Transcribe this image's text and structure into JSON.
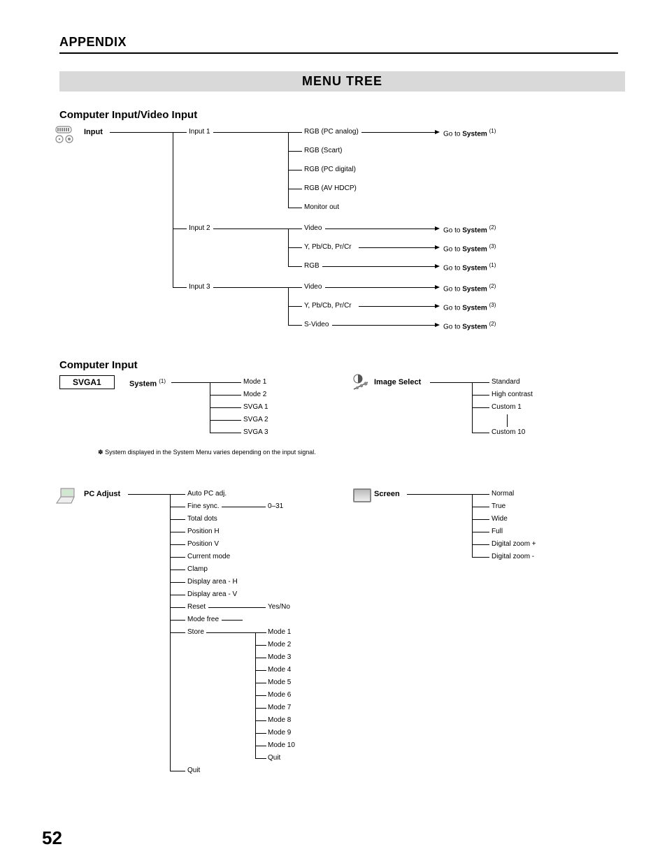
{
  "header": {
    "appendix": "APPENDIX",
    "banner": "MENU TREE"
  },
  "sections": {
    "s1_heading": "Computer Input/Video Input",
    "s2_heading": "Computer Input"
  },
  "input_tree": {
    "root": "Input",
    "input1": "Input 1",
    "input2": "Input 2",
    "input3": "Input 3",
    "i1": {
      "a": "RGB (PC analog)",
      "b": "RGB (Scart)",
      "c": "RGB (PC digital)",
      "d": "RGB (AV HDCP)",
      "e": "Monitor out"
    },
    "i2": {
      "a": "Video",
      "b": "Y, Pb/Cb, Pr/Cr",
      "c": "RGB"
    },
    "i3": {
      "a": "Video",
      "b": "Y, Pb/Cb, Pr/Cr",
      "c": "S-Video"
    },
    "goto": "Go to ",
    "system": "System",
    "sup1": "(1)",
    "sup2": "(2)",
    "sup3": "(3)"
  },
  "system_tree": {
    "svga_box": "SVGA1",
    "root": "System",
    "sup": "(1)",
    "m1": "Mode 1",
    "m2": "Mode 2",
    "m3": "SVGA 1",
    "m4": "SVGA 2",
    "m5": "SVGA 3",
    "note": "System displayed in the System Menu varies depending on the input signal.",
    "ast": "✽"
  },
  "image_select": {
    "root": "Image Select",
    "a": "Standard",
    "b": "High contrast",
    "c": "Custom 1",
    "d": "Custom 10"
  },
  "pc_adjust": {
    "root": "PC Adjust",
    "items": {
      "a": "Auto PC adj.",
      "b": "Fine sync.",
      "b_range": "0–31",
      "c": "Total dots",
      "d": "Position H",
      "e": "Position V",
      "f": "Current mode",
      "g": "Clamp",
      "h": "Display area - H",
      "i": "Display area - V",
      "j": "Reset",
      "j_yn": "Yes/No",
      "k": "Mode free",
      "l": "Store",
      "quit": "Quit"
    },
    "store_modes": {
      "m1": "Mode 1",
      "m2": "Mode 2",
      "m3": "Mode 3",
      "m4": "Mode 4",
      "m5": "Mode 5",
      "m6": "Mode 6",
      "m7": "Mode 7",
      "m8": "Mode 8",
      "m9": "Mode 9",
      "m10": "Mode 10",
      "q": "Quit"
    }
  },
  "screen": {
    "root": "Screen",
    "a": "Normal",
    "b": "True",
    "c": "Wide",
    "d": "Full",
    "e": "Digital zoom +",
    "f": "Digital zoom -"
  },
  "page_number": "52"
}
